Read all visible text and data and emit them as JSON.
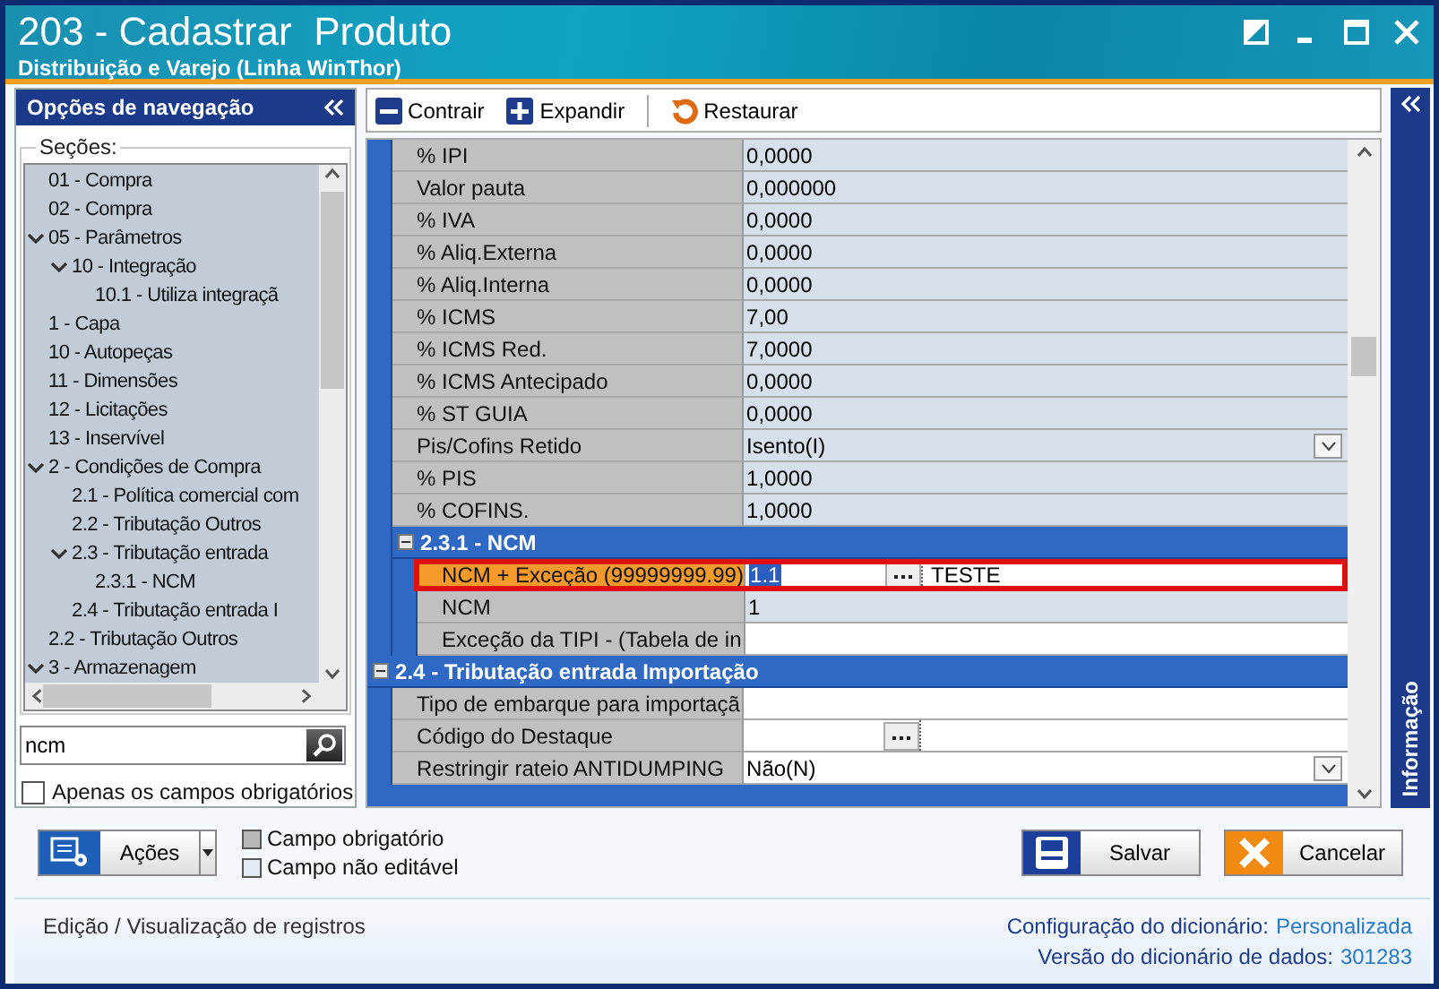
{
  "window": {
    "title": "203 - Cadastrar  Produto",
    "subtitle": "Distribuição e Varejo (Linha WinThor)"
  },
  "navigation": {
    "title": "Opções de navegação",
    "sections_label": "Seções:",
    "tree": [
      {
        "label": "01 - Compra"
      },
      {
        "label": "02 - Compra"
      },
      {
        "label": "05 - Parâmetros",
        "expanded": true,
        "children": [
          {
            "label": "10 - Integração",
            "expanded": true,
            "children": [
              {
                "label": "10.1 - Utiliza integraçã"
              }
            ]
          }
        ]
      },
      {
        "label": "1 - Capa"
      },
      {
        "label": "10 - Autopeças"
      },
      {
        "label": "11 - Dimensões"
      },
      {
        "label": "12 - Licitações"
      },
      {
        "label": "13 - Inservível"
      },
      {
        "label": "2 - Condições de Compra",
        "expanded": true,
        "children": [
          {
            "label": "2.1 - Política comercial com"
          },
          {
            "label": "2.2 - Tributação Outros"
          },
          {
            "label": "2.3 - Tributação entrada",
            "expanded": true,
            "children": [
              {
                "label": "2.3.1 - NCM"
              }
            ]
          },
          {
            "label": "2.4 - Tributação entrada I"
          }
        ]
      },
      {
        "label": "2.2 - Tributação Outros"
      },
      {
        "label": "3 - Armazenagem",
        "expanded": true
      }
    ],
    "search": {
      "value": "ncm"
    },
    "required_only": {
      "label": "Apenas os campos obrigatórios",
      "checked": false
    }
  },
  "toolbar": [
    {
      "kind": "collapse",
      "label": "Contrair"
    },
    {
      "kind": "expand",
      "label": "Expandir"
    },
    {
      "kind": "restore",
      "label": "Restaurar"
    }
  ],
  "grid": {
    "rows": [
      {
        "kind": "group_tail",
        "children": [
          {
            "kind": "text",
            "label": "% IPI",
            "value": "0,0000",
            "editable": false,
            "selected": false
          },
          {
            "kind": "text",
            "label": "Valor pauta",
            "value": "0,000000",
            "editable": false,
            "selected": false
          },
          {
            "kind": "text",
            "label": "% IVA",
            "value": "0,0000",
            "editable": false,
            "selected": false
          },
          {
            "kind": "text",
            "label": "% Aliq.Externa",
            "value": "0,0000",
            "editable": false,
            "selected": false
          },
          {
            "kind": "text",
            "label": "% Aliq.Interna",
            "value": "0,0000",
            "editable": false,
            "selected": false
          },
          {
            "kind": "text",
            "label": "% ICMS",
            "value": "7,00",
            "editable": false,
            "selected": false
          },
          {
            "kind": "text",
            "label": "% ICMS Red.",
            "value": "7,0000",
            "editable": false,
            "selected": false
          },
          {
            "kind": "text",
            "label": "% ICMS Antecipado",
            "value": "0,0000",
            "editable": false,
            "selected": false
          },
          {
            "kind": "text",
            "label": "% ST GUIA",
            "value": "0,0000",
            "editable": false,
            "selected": false
          },
          {
            "kind": "dropdown",
            "label": "Pis/Cofins Retido",
            "value": "Isento(I)",
            "editable": false,
            "selected": false
          },
          {
            "kind": "text",
            "label": "% PIS",
            "value": "1,0000",
            "editable": false,
            "selected": false
          },
          {
            "kind": "text",
            "label": "% COFINS.",
            "value": "1,0000",
            "editable": false,
            "selected": false
          },
          {
            "kind": "group",
            "title": "2.3.1 - NCM",
            "expanded": true,
            "children": [
              {
                "kind": "lookup",
                "label": "NCM + Exceção (99999999.99)",
                "value": "1.1",
                "description": "TESTE",
                "editable": true,
                "selected": true
              },
              {
                "kind": "text",
                "label": "NCM",
                "value": "1",
                "editable": false,
                "selected": false
              },
              {
                "kind": "text",
                "label": "Exceção da TIPI - (Tabela de in",
                "editable": true,
                "selected": false
              }
            ]
          }
        ]
      },
      {
        "kind": "group",
        "title": "2.4 - Tributação entrada Importação",
        "expanded": true,
        "children": [
          {
            "kind": "text",
            "label": "Tipo de embarque para importaçã",
            "editable": true,
            "selected": false
          },
          {
            "kind": "lookup",
            "label": "Código do Destaque",
            "editable": true,
            "selected": false
          },
          {
            "kind": "dropdown",
            "label": "Restringir rateio ANTIDUMPING",
            "value": "Não(N)",
            "editable": true,
            "selected": false
          }
        ]
      }
    ]
  },
  "info_panel": {
    "title": "Informação"
  },
  "actions_button": {
    "label": "Ações"
  },
  "legend": [
    {
      "kind": "required",
      "label": "Campo obrigatório"
    },
    {
      "kind": "readonly",
      "label": "Campo não editável"
    }
  ],
  "buttons": [
    {
      "kind": "save",
      "label": "Salvar"
    },
    {
      "kind": "cancel",
      "label": "Cancelar"
    }
  ],
  "status": {
    "left": "Edição / Visualização de registros",
    "config_label": "Configuração do dicionário:",
    "config_value": "Personalizada",
    "version_label": "Versão do dicionário de dados:",
    "version_value": "301283"
  }
}
